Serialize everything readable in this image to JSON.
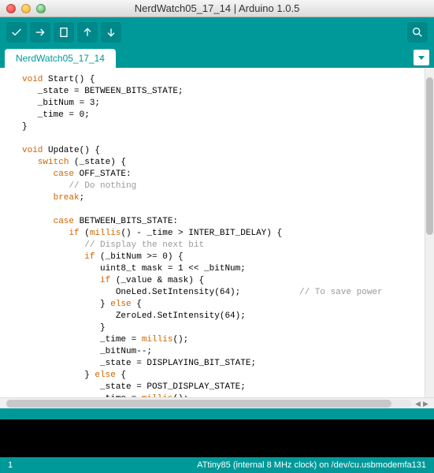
{
  "window": {
    "title": "NerdWatch05_17_14 | Arduino 1.0.5"
  },
  "toolbar": {
    "verify": "Verify",
    "upload": "Upload",
    "new": "New",
    "open": "Open",
    "save": "Save",
    "serial_monitor": "Serial Monitor"
  },
  "tabs": {
    "active": "NerdWatch05_17_14"
  },
  "code": {
    "l01a": "void",
    "l01b": " Start() {",
    "l02": "   _state = BETWEEN_BITS_STATE;",
    "l03": "   _bitNum = 3;",
    "l04": "   _time = 0;",
    "l05": "}",
    "l06": "",
    "l07a": "void",
    "l07b": " Update() {",
    "l08a": "   ",
    "l08b": "switch",
    "l08c": " (_state) {",
    "l09a": "      ",
    "l09b": "case",
    "l09c": " OFF_STATE:",
    "l10a": "         ",
    "l10b": "// Do nothing",
    "l11a": "      ",
    "l11b": "break",
    "l11c": ";",
    "l12": "",
    "l13a": "      ",
    "l13b": "case",
    "l13c": " BETWEEN_BITS_STATE:",
    "l14a": "         ",
    "l14b": "if",
    "l14c": " (",
    "l14d": "millis",
    "l14e": "() - _time > INTER_BIT_DELAY) {",
    "l15a": "            ",
    "l15b": "// Display the next bit",
    "l16a": "            ",
    "l16b": "if",
    "l16c": " (_bitNum >= 0) {",
    "l17": "               uint8_t mask = 1 << _bitNum;",
    "l18a": "               ",
    "l18b": "if",
    "l18c": " (_value & mask) {",
    "l19": "                  OneLed.SetIntensity(64);",
    "l19cmt": "// To save power",
    "l20a": "               } ",
    "l20b": "else",
    "l20c": " {",
    "l21": "                  ZeroLed.SetIntensity(64);",
    "l22": "               }",
    "l23a": "               _time = ",
    "l23b": "millis",
    "l23c": "();",
    "l24": "               _bitNum--;",
    "l25": "               _state = DISPLAYING_BIT_STATE;",
    "l26a": "            } ",
    "l26b": "else",
    "l26c": " {",
    "l27": "               _state = POST_DISPLAY_STATE;",
    "l28a": "               _time = ",
    "l28b": "millis",
    "l28c": "();",
    "l29": "            }",
    "l30": "         }"
  },
  "status": {
    "line_number": "1",
    "board_info": "ATtiny85 (internal 8 MHz clock) on /dev/cu.usbmodemfa131"
  }
}
